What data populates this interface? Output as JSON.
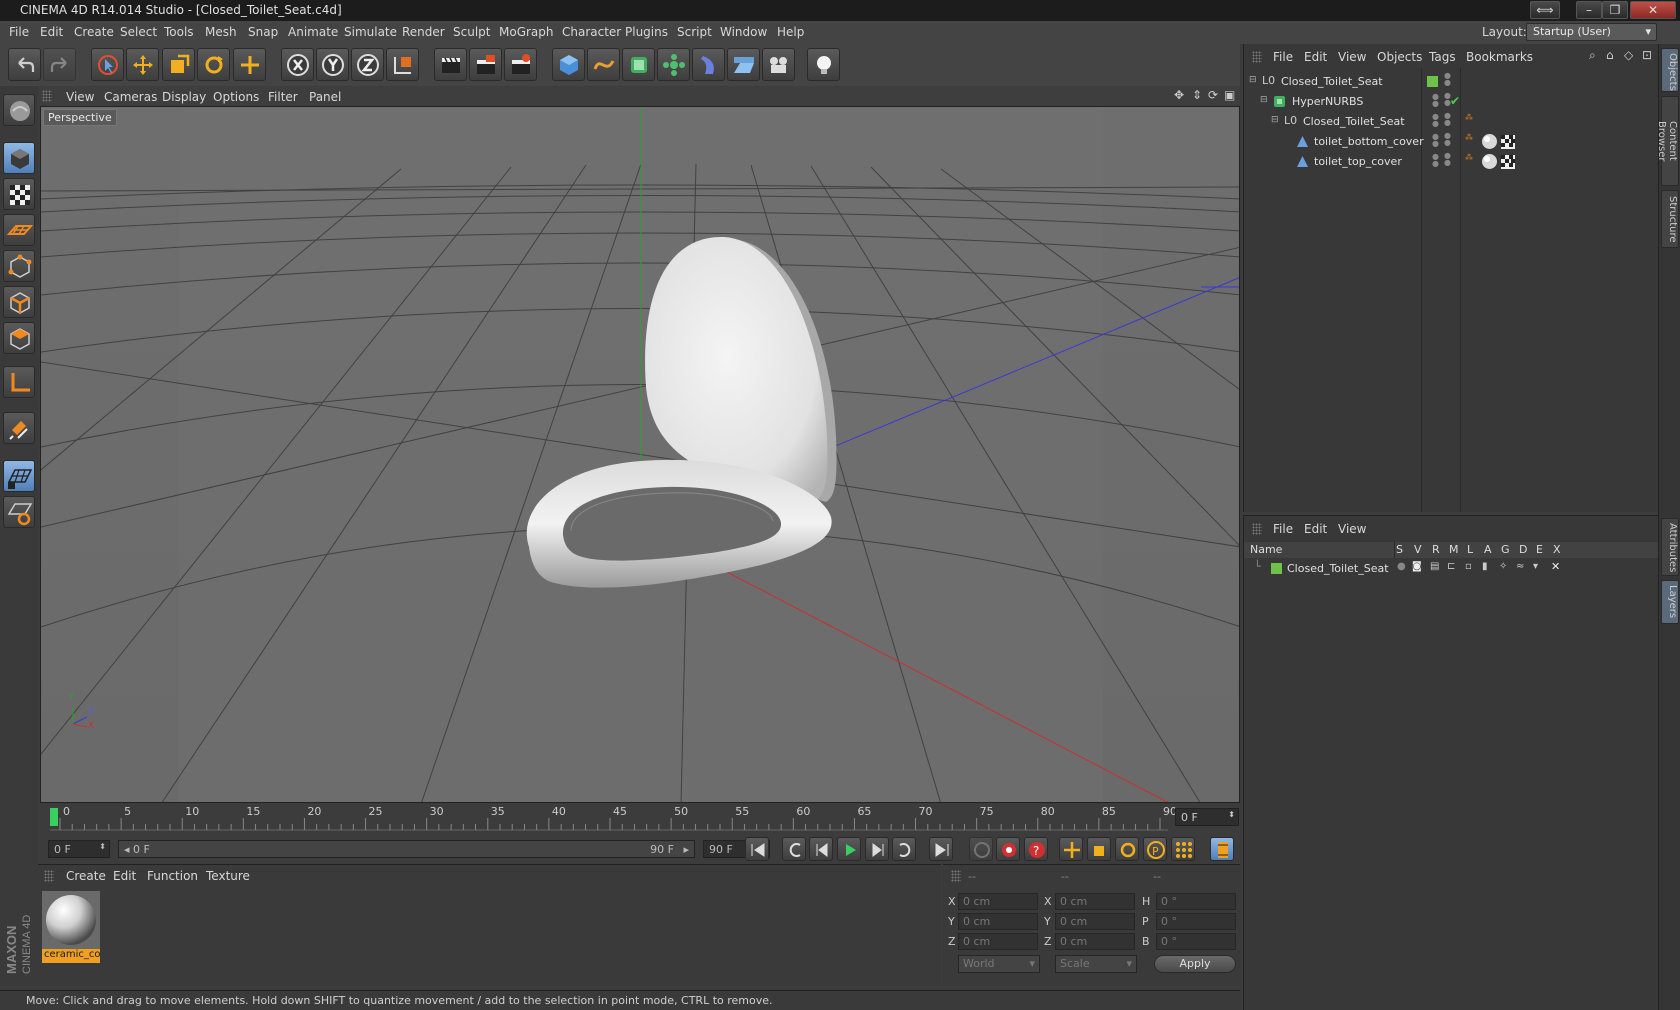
{
  "window": {
    "title": "CINEMA 4D R14.014 Studio - [Closed_Toilet_Seat.c4d]"
  },
  "menubar": {
    "items": [
      "File",
      "Edit",
      "Create",
      "Select",
      "Tools",
      "Mesh",
      "Snap",
      "Animate",
      "Simulate",
      "Render",
      "Sculpt",
      "MoGraph",
      "Character",
      "Plugins",
      "Script",
      "Window",
      "Help"
    ],
    "layout_label": "Layout:",
    "layout_value": "Startup (User)"
  },
  "toolbar": {
    "icons": [
      "undo-icon",
      "redo-icon",
      "live-selection-icon",
      "move-icon",
      "scale-icon",
      "rotate-icon",
      "add-object-icon",
      "x-axis-icon",
      "y-axis-icon",
      "z-axis-icon",
      "coordinate-system-icon",
      "render-view-icon",
      "render-picture-viewer-icon",
      "render-settings-icon",
      "cube-icon",
      "spline-icon",
      "nurbs-icon",
      "array-icon",
      "deformer-icon",
      "scene-floor-icon",
      "camera-icon",
      "light-icon"
    ]
  },
  "left_tools": {
    "icons": [
      "model-mode-icon",
      "object-mode-icon",
      "texture-mode-icon",
      "workplane-icon",
      "points-mode-icon",
      "edges-mode-icon",
      "polygons-mode-icon",
      "axis-mode-icon",
      "magnet-icon",
      "grid-snap-icon",
      "lock-workplane-icon"
    ]
  },
  "viewport": {
    "menu": [
      "View",
      "Cameras",
      "Display",
      "Options",
      "Filter",
      "Panel"
    ],
    "label": "Perspective",
    "axis_labels": {
      "y": "Y",
      "z": "Z",
      "x": "X"
    }
  },
  "timeline": {
    "ticks": [
      "0",
      "5",
      "10",
      "15",
      "20",
      "25",
      "30",
      "35",
      "40",
      "45",
      "50",
      "55",
      "60",
      "65",
      "70",
      "75",
      "80",
      "85",
      "90"
    ],
    "current_frame_field": "0 F",
    "start_field": "0 F",
    "range_start": "0 F",
    "range_end": "90 F",
    "end_field": "90 F"
  },
  "materials": {
    "menu": [
      "Create",
      "Edit",
      "Function",
      "Texture"
    ],
    "items": [
      {
        "name": "ceramic_co"
      }
    ]
  },
  "coordinates": {
    "headers": [
      "--",
      "--",
      "--"
    ],
    "rows": [
      {
        "a": "X",
        "av": "0 cm",
        "b": "X",
        "bv": "0 cm",
        "c": "H",
        "cv": "0 °"
      },
      {
        "a": "Y",
        "av": "0 cm",
        "b": "Y",
        "bv": "0 cm",
        "c": "P",
        "cv": "0 °"
      },
      {
        "a": "Z",
        "av": "0 cm",
        "b": "Z",
        "bv": "0 cm",
        "c": "B",
        "cv": "0 °"
      }
    ],
    "space": "World",
    "mode": "Scale",
    "apply": "Apply"
  },
  "status": {
    "text": "Move: Click and drag to move elements. Hold down SHIFT to quantize movement / add to the selection in point mode, CTRL to remove."
  },
  "object_manager": {
    "menu": [
      "File",
      "Edit",
      "View",
      "Objects",
      "Tags",
      "Bookmarks"
    ],
    "rows": [
      {
        "name": "Closed_Toilet_Seat",
        "icon": "null-object-icon"
      },
      {
        "name": "HyperNURBS",
        "icon": "hypernurbs-icon"
      },
      {
        "name": "Closed_Toilet_Seat",
        "icon": "null-object-icon"
      },
      {
        "name": "toilet_bottom_cover",
        "icon": "polygon-object-icon"
      },
      {
        "name": "toilet_top_cover",
        "icon": "polygon-object-icon"
      }
    ]
  },
  "layer_manager": {
    "menu": [
      "File",
      "Edit",
      "View"
    ],
    "columns": [
      "Name",
      "S",
      "V",
      "R",
      "M",
      "L",
      "A",
      "G",
      "D",
      "E",
      "X"
    ],
    "rows": [
      {
        "name": "Closed_Toilet_Seat",
        "color": "#6ec24a"
      }
    ]
  },
  "right_tabs": [
    "Objects",
    "Content Browser",
    "Structure",
    "Attributes",
    "Layers"
  ],
  "colors": {
    "accent": "#8fb8e6",
    "layer_green": "#6ec24a",
    "material_label": "#f0a020"
  }
}
